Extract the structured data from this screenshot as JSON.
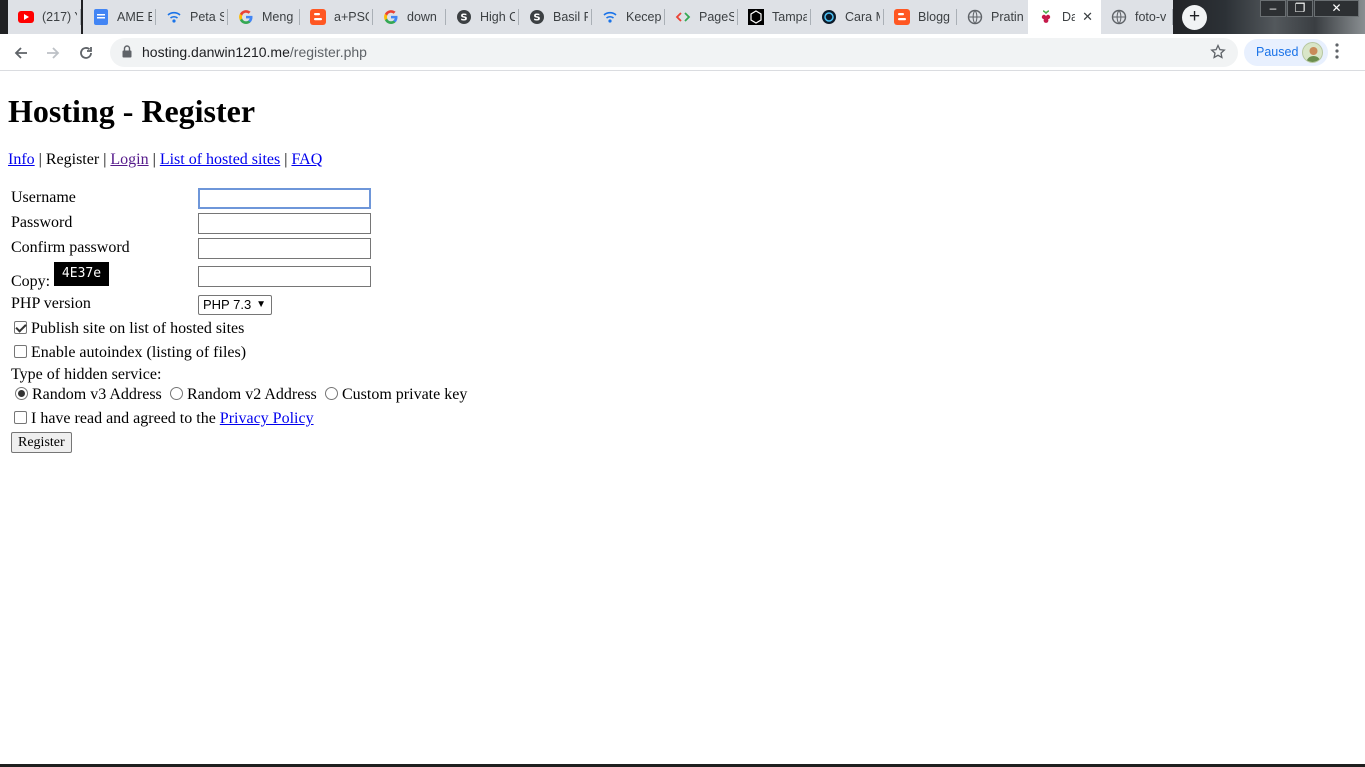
{
  "browser": {
    "tabs": [
      {
        "title": "(217) Y",
        "icon": "youtube-icon"
      },
      {
        "title": "AME E",
        "icon": "docs-icon"
      },
      {
        "title": "Peta S",
        "icon": "network-icon"
      },
      {
        "title": "Meng",
        "icon": "google-icon"
      },
      {
        "title": "a+PSC",
        "icon": "blogger-icon"
      },
      {
        "title": "down",
        "icon": "google-icon"
      },
      {
        "title": "High C",
        "icon": "s-logo-icon"
      },
      {
        "title": "Basil P",
        "icon": "s-logo-icon"
      },
      {
        "title": "Kecep",
        "icon": "network-icon"
      },
      {
        "title": "PageS",
        "icon": "code-icon"
      },
      {
        "title": "Tampa",
        "icon": "hexagon-icon"
      },
      {
        "title": "Cara M",
        "icon": "circle-logo-icon"
      },
      {
        "title": "Blogg",
        "icon": "blogger-icon"
      },
      {
        "title": "Pratin",
        "icon": "globe-icon"
      },
      {
        "title": "Da",
        "icon": "raspberry-icon"
      },
      {
        "title": "foto-v",
        "icon": "globe-icon"
      }
    ],
    "active_tab_index": 14,
    "url_host": "hosting.danwin1210.me",
    "url_path": "/register.php",
    "profile_label": "Paused",
    "colors": {
      "accent": "#1a73e8",
      "tabstrip": "#202124",
      "tab_inactive": "#dee1e6",
      "link": "#0000ee",
      "link_visited": "#551a8b"
    }
  },
  "page": {
    "title": "Hosting - Register",
    "nav": [
      {
        "label": "Info",
        "link": true,
        "visited": false
      },
      {
        "label": "Register",
        "link": false,
        "visited": false
      },
      {
        "label": "Login",
        "link": true,
        "visited": true
      },
      {
        "label": "List of hosted sites",
        "link": true,
        "visited": false
      },
      {
        "label": "FAQ",
        "link": true,
        "visited": false
      }
    ],
    "nav_separator": "|",
    "form": {
      "username_label": "Username",
      "username_value": "",
      "password_label": "Password",
      "password_value": "",
      "confirm_label": "Confirm password",
      "confirm_value": "",
      "copy_label": "Copy:",
      "captcha_text": "4E37e",
      "captcha_value": "",
      "php_label": "PHP version",
      "php_selected": "PHP 7.3",
      "publish_label": "Publish site on list of hosted sites",
      "publish_checked": true,
      "autoindex_label": "Enable autoindex (listing of files)",
      "autoindex_checked": false,
      "hidden_service_label": "Type of hidden service:",
      "hidden_service_options": [
        {
          "label": "Random v3 Address",
          "checked": true
        },
        {
          "label": "Random v2 Address",
          "checked": false
        },
        {
          "label": "Custom private key",
          "checked": false
        }
      ],
      "agree_prefix": "I have read and agreed to the",
      "privacy_link_label": "Privacy Policy",
      "agree_checked": false,
      "register_label": "Register"
    }
  }
}
